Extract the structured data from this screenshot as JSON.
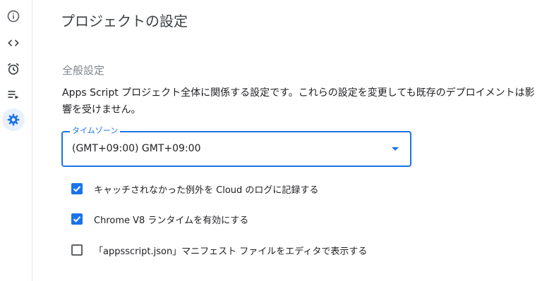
{
  "rail": {
    "items": [
      {
        "icon": "info-icon"
      },
      {
        "icon": "code-icon"
      },
      {
        "icon": "alarm-icon"
      },
      {
        "icon": "executions-icon"
      },
      {
        "icon": "gear-icon",
        "active": true
      }
    ]
  },
  "page": {
    "title": "プロジェクトの設定"
  },
  "general": {
    "section_title": "全般設定",
    "description": "Apps Script プロジェクト全体に関係する設定です。これらの設定を変更しても既存のデプロイメントは影響を受けません。"
  },
  "timezone": {
    "label": "タイムゾーン",
    "value": "(GMT+09:00) GMT+09:00"
  },
  "options": [
    {
      "label": "キャッチされなかった例外を Cloud のログに記録する",
      "checked": true
    },
    {
      "label": "Chrome V8 ランタイムを有効にする",
      "checked": true
    },
    {
      "label": "「appsscript.json」マニフェスト ファイルをエディタで表示する",
      "checked": false
    }
  ],
  "colors": {
    "accent": "#1a73e8",
    "icon": "#5f6368",
    "active_bg": "#e8f0fe"
  }
}
